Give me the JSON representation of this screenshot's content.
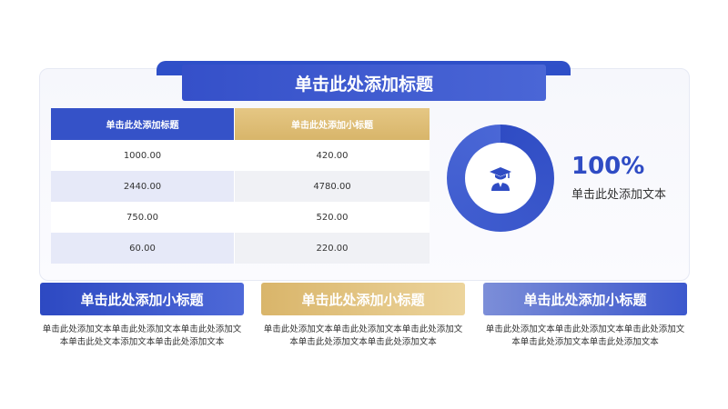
{
  "title": "单击此处添加标题",
  "table": {
    "headers": [
      "单击此处添加标题",
      "单击此处添加小标题"
    ],
    "rows": [
      [
        "1000.00",
        "420.00"
      ],
      [
        "2440.00",
        "4780.00"
      ],
      [
        "750.00",
        "520.00"
      ],
      [
        "60.00",
        "220.00"
      ]
    ]
  },
  "stat": {
    "value": "100%",
    "caption": "单击此处添加文本",
    "icon": "graduate-icon"
  },
  "cards": [
    {
      "title": "单击此处添加小标题",
      "text": "单击此处添加文本单击此处添加文本单击此处添加文本单击此处文本添加文本单击此处添加文本"
    },
    {
      "title": "单击此处添加小标题",
      "text": "单击此处添加文本单击此处添加文本单击此处添加文本单击此处添加文本单击此处添加文本"
    },
    {
      "title": "单击此处添加小标题",
      "text": "单击此处添加文本单击此处添加文本单击此处添加文本单击此处添加文本单击此处添加文本"
    }
  ],
  "colors": {
    "primary": "#2f4cc4",
    "gold": "#d9b56a",
    "text": "#333333"
  }
}
